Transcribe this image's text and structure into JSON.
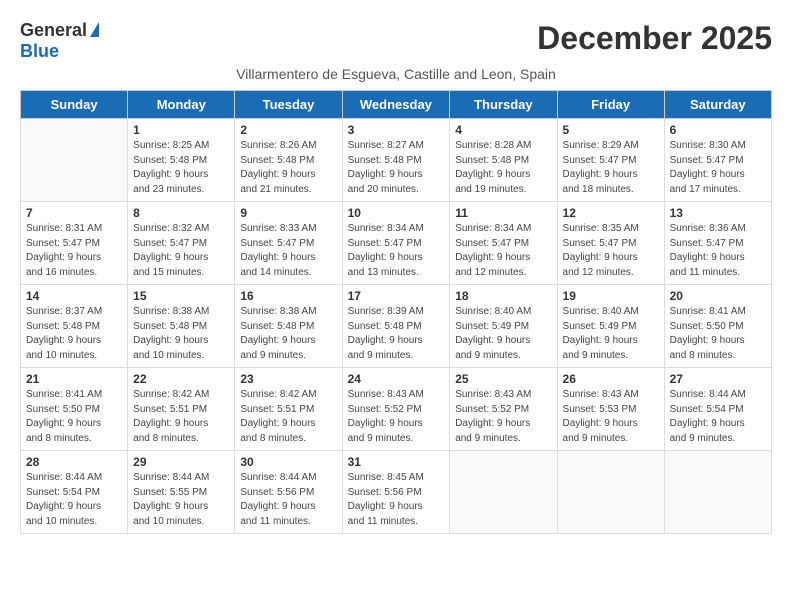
{
  "logo": {
    "general": "General",
    "blue": "Blue"
  },
  "title": "December 2025",
  "subtitle": "Villarmentero de Esgueva, Castille and Leon, Spain",
  "weekdays": [
    "Sunday",
    "Monday",
    "Tuesday",
    "Wednesday",
    "Thursday",
    "Friday",
    "Saturday"
  ],
  "weeks": [
    [
      {
        "day": "",
        "info": ""
      },
      {
        "day": "1",
        "info": "Sunrise: 8:25 AM\nSunset: 5:48 PM\nDaylight: 9 hours\nand 23 minutes."
      },
      {
        "day": "2",
        "info": "Sunrise: 8:26 AM\nSunset: 5:48 PM\nDaylight: 9 hours\nand 21 minutes."
      },
      {
        "day": "3",
        "info": "Sunrise: 8:27 AM\nSunset: 5:48 PM\nDaylight: 9 hours\nand 20 minutes."
      },
      {
        "day": "4",
        "info": "Sunrise: 8:28 AM\nSunset: 5:48 PM\nDaylight: 9 hours\nand 19 minutes."
      },
      {
        "day": "5",
        "info": "Sunrise: 8:29 AM\nSunset: 5:47 PM\nDaylight: 9 hours\nand 18 minutes."
      },
      {
        "day": "6",
        "info": "Sunrise: 8:30 AM\nSunset: 5:47 PM\nDaylight: 9 hours\nand 17 minutes."
      }
    ],
    [
      {
        "day": "7",
        "info": "Sunrise: 8:31 AM\nSunset: 5:47 PM\nDaylight: 9 hours\nand 16 minutes."
      },
      {
        "day": "8",
        "info": "Sunrise: 8:32 AM\nSunset: 5:47 PM\nDaylight: 9 hours\nand 15 minutes."
      },
      {
        "day": "9",
        "info": "Sunrise: 8:33 AM\nSunset: 5:47 PM\nDaylight: 9 hours\nand 14 minutes."
      },
      {
        "day": "10",
        "info": "Sunrise: 8:34 AM\nSunset: 5:47 PM\nDaylight: 9 hours\nand 13 minutes."
      },
      {
        "day": "11",
        "info": "Sunrise: 8:34 AM\nSunset: 5:47 PM\nDaylight: 9 hours\nand 12 minutes."
      },
      {
        "day": "12",
        "info": "Sunrise: 8:35 AM\nSunset: 5:47 PM\nDaylight: 9 hours\nand 12 minutes."
      },
      {
        "day": "13",
        "info": "Sunrise: 8:36 AM\nSunset: 5:47 PM\nDaylight: 9 hours\nand 11 minutes."
      }
    ],
    [
      {
        "day": "14",
        "info": "Sunrise: 8:37 AM\nSunset: 5:48 PM\nDaylight: 9 hours\nand 10 minutes."
      },
      {
        "day": "15",
        "info": "Sunrise: 8:38 AM\nSunset: 5:48 PM\nDaylight: 9 hours\nand 10 minutes."
      },
      {
        "day": "16",
        "info": "Sunrise: 8:38 AM\nSunset: 5:48 PM\nDaylight: 9 hours\nand 9 minutes."
      },
      {
        "day": "17",
        "info": "Sunrise: 8:39 AM\nSunset: 5:48 PM\nDaylight: 9 hours\nand 9 minutes."
      },
      {
        "day": "18",
        "info": "Sunrise: 8:40 AM\nSunset: 5:49 PM\nDaylight: 9 hours\nand 9 minutes."
      },
      {
        "day": "19",
        "info": "Sunrise: 8:40 AM\nSunset: 5:49 PM\nDaylight: 9 hours\nand 9 minutes."
      },
      {
        "day": "20",
        "info": "Sunrise: 8:41 AM\nSunset: 5:50 PM\nDaylight: 9 hours\nand 8 minutes."
      }
    ],
    [
      {
        "day": "21",
        "info": "Sunrise: 8:41 AM\nSunset: 5:50 PM\nDaylight: 9 hours\nand 8 minutes."
      },
      {
        "day": "22",
        "info": "Sunrise: 8:42 AM\nSunset: 5:51 PM\nDaylight: 9 hours\nand 8 minutes."
      },
      {
        "day": "23",
        "info": "Sunrise: 8:42 AM\nSunset: 5:51 PM\nDaylight: 9 hours\nand 8 minutes."
      },
      {
        "day": "24",
        "info": "Sunrise: 8:43 AM\nSunset: 5:52 PM\nDaylight: 9 hours\nand 9 minutes."
      },
      {
        "day": "25",
        "info": "Sunrise: 8:43 AM\nSunset: 5:52 PM\nDaylight: 9 hours\nand 9 minutes."
      },
      {
        "day": "26",
        "info": "Sunrise: 8:43 AM\nSunset: 5:53 PM\nDaylight: 9 hours\nand 9 minutes."
      },
      {
        "day": "27",
        "info": "Sunrise: 8:44 AM\nSunset: 5:54 PM\nDaylight: 9 hours\nand 9 minutes."
      }
    ],
    [
      {
        "day": "28",
        "info": "Sunrise: 8:44 AM\nSunset: 5:54 PM\nDaylight: 9 hours\nand 10 minutes."
      },
      {
        "day": "29",
        "info": "Sunrise: 8:44 AM\nSunset: 5:55 PM\nDaylight: 9 hours\nand 10 minutes."
      },
      {
        "day": "30",
        "info": "Sunrise: 8:44 AM\nSunset: 5:56 PM\nDaylight: 9 hours\nand 11 minutes."
      },
      {
        "day": "31",
        "info": "Sunrise: 8:45 AM\nSunset: 5:56 PM\nDaylight: 9 hours\nand 11 minutes."
      },
      {
        "day": "",
        "info": ""
      },
      {
        "day": "",
        "info": ""
      },
      {
        "day": "",
        "info": ""
      }
    ]
  ]
}
